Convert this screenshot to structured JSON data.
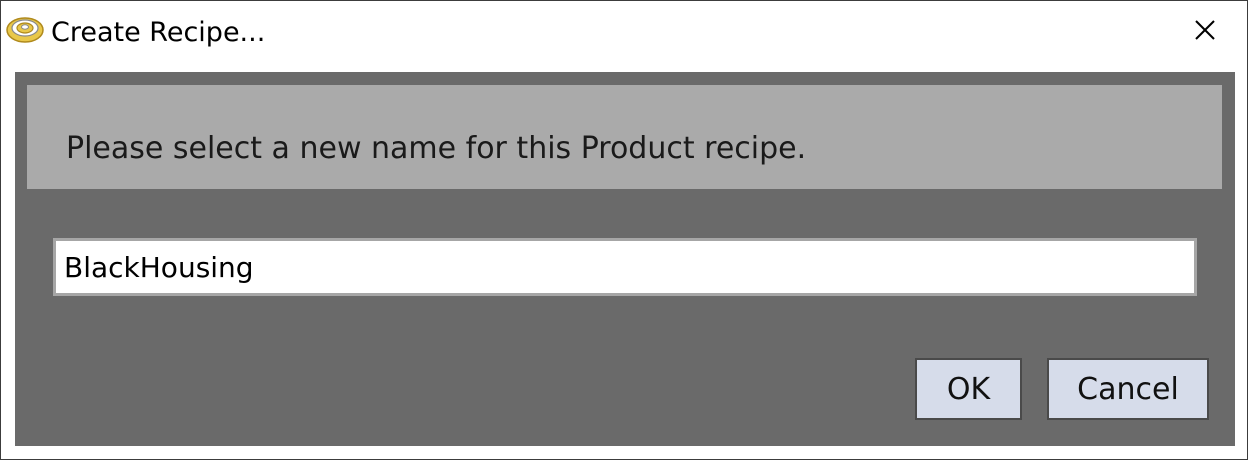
{
  "window": {
    "title": "Create Recipe...",
    "app_icon": "spiral-target-icon",
    "close_icon": "close-icon"
  },
  "message": {
    "text": "Please select a new name for this Product recipe."
  },
  "name_input": {
    "value": "BlackHousing"
  },
  "buttons": {
    "ok_label": "OK",
    "cancel_label": "Cancel"
  },
  "colors": {
    "client_background": "#6a6a6a",
    "message_panel": "#aaaaaa",
    "button_background": "#d6dcea"
  }
}
